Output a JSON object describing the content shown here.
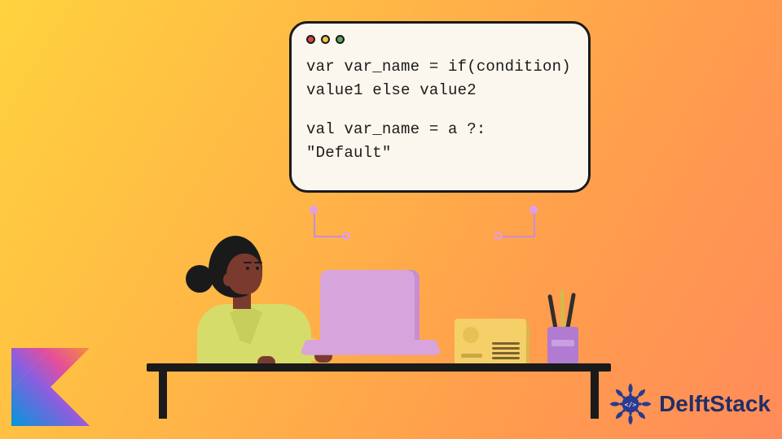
{
  "code_box": {
    "line1": "var var_name = if(condition)",
    "line2": "value1 else value2",
    "line3": "val var_name = a ?:",
    "line4": "\"Default\""
  },
  "brand": {
    "name": "DelftStack"
  },
  "logos": {
    "kotlin_name": "kotlin-logo-icon",
    "delft_name": "delftstack-logo-icon"
  },
  "colors": {
    "bg_grad_start": "#ffd23e",
    "bg_grad_end": "#ff8b5a",
    "codebox_bg": "#fcf7ee",
    "stroke": "#1a1a1a",
    "laptop": "#d8a4dc",
    "jacket": "#d5dc6a",
    "skin": "#7a3b2e",
    "card": "#f5d068",
    "cup": "#b07bd1",
    "delft_blue": "#232e66"
  }
}
